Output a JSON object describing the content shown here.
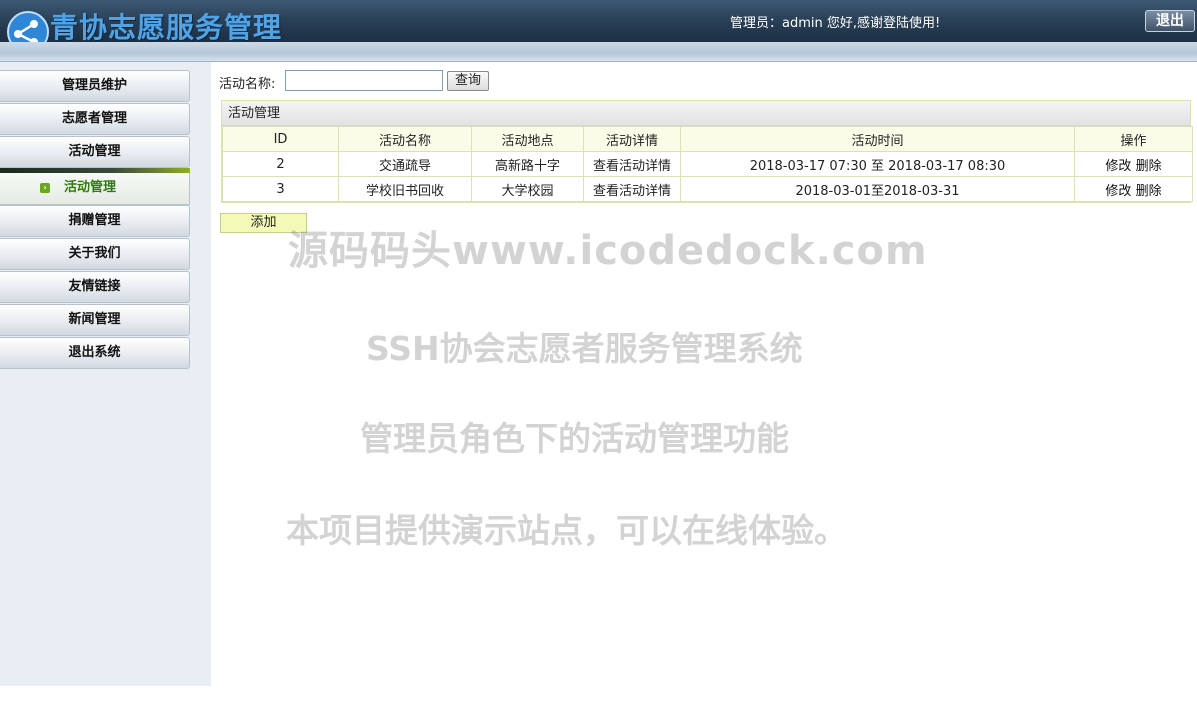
{
  "header": {
    "app_title": "青协志愿服务管理",
    "welcome_prefix": "管理员：",
    "admin_name": "admin",
    "welcome_suffix": " 您好,感谢登陆使用!",
    "logout_label": "退出"
  },
  "sidebar": {
    "items": [
      {
        "label": "管理员维护"
      },
      {
        "label": "志愿者管理"
      },
      {
        "label": "活动管理"
      },
      {
        "label": "捐赠管理"
      },
      {
        "label": "关于我们"
      },
      {
        "label": "友情链接"
      },
      {
        "label": "新闻管理"
      },
      {
        "label": "退出系统"
      }
    ],
    "active_sub_item": {
      "label": "活动管理",
      "icon": "arrow-right-icon"
    }
  },
  "search": {
    "label": "活动名称:",
    "value": "",
    "button_label": "查询"
  },
  "grid": {
    "caption": "活动管理",
    "columns": [
      "ID",
      "活动名称",
      "活动地点",
      "活动详情",
      "活动时间",
      "操作"
    ],
    "rows": [
      {
        "id": "2",
        "name": "交通疏导",
        "location": "高新路十字",
        "detail": "查看活动详情",
        "time": "2018-03-17 07:30 至 2018-03-17 08:30",
        "edit": "修改",
        "delete": "删除"
      },
      {
        "id": "3",
        "name": "学校旧书回收",
        "location": "大学校园",
        "detail": "查看活动详情",
        "time": "2018-03-01至2018-03-31",
        "edit": "修改",
        "delete": "删除"
      }
    ]
  },
  "add_button_label": "添加",
  "watermarks": [
    "源码码头www.icodedock.com",
    "SSH协会志愿者服务管理系统",
    "管理员角色下的活动管理功能",
    "本项目提供演示站点，可以在线体验。"
  ],
  "colors": {
    "header_dark": "#1c2f43",
    "title_blue": "#4fa3e6",
    "active_green": "#2f7a0d",
    "table_border": "#dbe2b0",
    "add_button_bg": "#f4f9b8"
  }
}
